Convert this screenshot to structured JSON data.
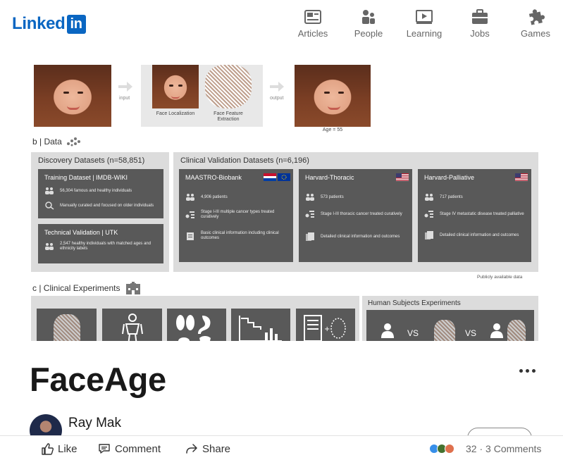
{
  "nav": {
    "logo_text": "Linked",
    "logo_in": "in",
    "items": [
      {
        "label": "Articles",
        "icon": "articles-icon"
      },
      {
        "label": "People",
        "icon": "people-icon"
      },
      {
        "label": "Learning",
        "icon": "learning-icon"
      },
      {
        "label": "Jobs",
        "icon": "jobs-icon"
      },
      {
        "label": "Games",
        "icon": "games-icon"
      }
    ]
  },
  "figure": {
    "input_label": "input",
    "output_label": "output",
    "face_localization": "Face Localization",
    "face_feature_extraction": "Face Feature Extraction",
    "age_caption": "Age = 55",
    "section_b": "b | Data",
    "discovery_title": "Discovery Datasets (n=58,851)",
    "clinical_title": "Clinical Validation Datasets (n=6,196)",
    "cards": {
      "training": {
        "title": "Training Dataset | IMDB-WIKI",
        "line1": "56,304 famous and healthy individuals",
        "line2": "Manually curated and focused on older individuals"
      },
      "technical": {
        "title": "Technical Validation | UTK",
        "line1": "2,547 healthy individuals with matched ages and ethnicity labels"
      },
      "maastro": {
        "title": "MAASTRO-Biobank",
        "line1": "4,906 patients",
        "line2": "Stage I-III multiple cancer types treated curatively",
        "line3": "Basic clinical information including clinical outcomes"
      },
      "thoracic": {
        "title": "Harvard-Thoracic",
        "line1": "573 patients",
        "line2": "Stage I-III thoracic cancer treated curatively",
        "line3": "Detailed clinical information and outcomes"
      },
      "palliative": {
        "title": "Harvard-Palliative",
        "line1": "717 patients",
        "line2": "Stage IV metastatic disease treated palliative",
        "line3": "Detailed clinical information and outcomes"
      }
    },
    "public_note": "Publicly available data",
    "section_c": "c | Clinical Experiments",
    "human_subjects": "Human Subjects Experiments",
    "vs": "VS"
  },
  "article": {
    "title": "FaceAge",
    "author": "Ray Mak"
  },
  "actions": {
    "like": "Like",
    "comment": "Comment",
    "share": "Share",
    "count": "32",
    "comments": "3 Comments"
  },
  "colors": {
    "brand": "#0a66c2",
    "card_gray": "#595959"
  }
}
